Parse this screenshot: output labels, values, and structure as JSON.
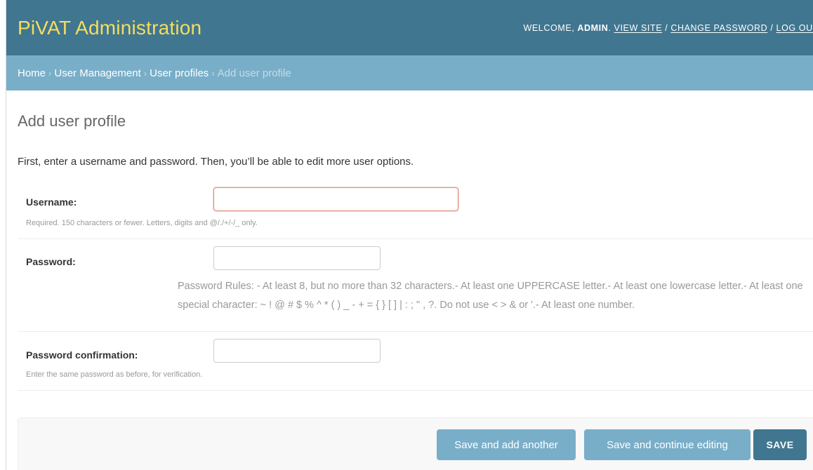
{
  "header": {
    "site_name": "PiVAT Administration",
    "welcome_prefix": "Welcome, ",
    "username": "admin",
    "welcome_suffix": ". ",
    "view_site": "View site",
    "sep1": " / ",
    "change_password": "Change password",
    "sep2": " / ",
    "log_out": "Log out"
  },
  "breadcrumbs": {
    "items": [
      "Home",
      "User Management",
      "User profiles"
    ],
    "separator": "›",
    "current": "Add user profile"
  },
  "main": {
    "title": "Add user profile",
    "intro": "First, enter a username and password. Then, you’ll be able to edit more user options."
  },
  "form": {
    "username": {
      "label": "Username:",
      "value": "",
      "help": "Required. 150 characters or fewer. Letters, digits and @/./+/-/_ only."
    },
    "password": {
      "label": "Password:",
      "value": "",
      "rules": "Password Rules: - At least 8, but no more than 32 characters.- At least one UPPERCASE letter.- At least one lowercase letter.- At least one special character: ~ ! @ # $ % ^ * ( ) _ - + = { } [ ] | : ; \" , ?. Do not use < > & or '.- At least one number."
    },
    "password_confirmation": {
      "label": "Password confirmation:",
      "value": "",
      "help": "Enter the same password as before, for verification."
    }
  },
  "actions": {
    "save_and_add_another": "Save and add another",
    "save_and_continue": "Save and continue editing",
    "save": "SAVE"
  },
  "colors": {
    "header_bg": "#417690",
    "branding": "#f5dd5d",
    "breadcrumbs_bg": "#79aec8",
    "primary_button": "#417690",
    "secondary_button": "#79aec8",
    "error_border": "#e0907a"
  }
}
